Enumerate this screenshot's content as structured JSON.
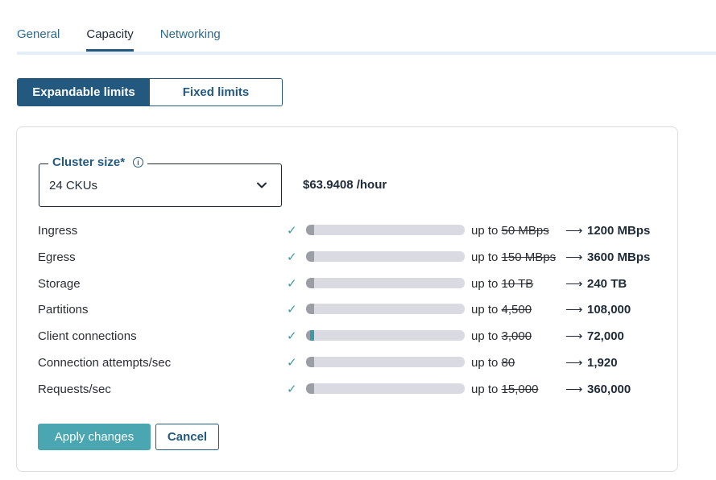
{
  "tabs": [
    {
      "label": "General",
      "active": false
    },
    {
      "label": "Capacity",
      "active": true
    },
    {
      "label": "Networking",
      "active": false
    }
  ],
  "limits_toggle": {
    "expandable_label": "Expandable limits",
    "fixed_label": "Fixed limits",
    "selected": "Expandable limits"
  },
  "cluster": {
    "label": "Cluster size*",
    "info_icon": "info-icon",
    "value": "24 CKUs",
    "price": "$63.9408 /hour"
  },
  "metrics": [
    {
      "label": "Ingress",
      "upto": "up to",
      "old": "50 MBps",
      "new": "1200 MBps",
      "fill": 0.05
    },
    {
      "label": "Egress",
      "upto": "up to",
      "old": "150 MBps",
      "new": "3600 MBps",
      "fill": 0.05
    },
    {
      "label": "Storage",
      "upto": "up to",
      "old": "10 TB",
      "new": "240 TB",
      "fill": 0.05
    },
    {
      "label": "Partitions",
      "upto": "up to",
      "old": "4,500",
      "new": "108,000",
      "fill": 0.05
    },
    {
      "label": "Client connections",
      "upto": "up to",
      "old": "3,000",
      "new": "72,000",
      "fill": 0.05,
      "accent": "#3d97a6"
    },
    {
      "label": "Connection attempts/sec",
      "upto": "up to",
      "old": "80",
      "new": "1,920",
      "fill": 0.05
    },
    {
      "label": "Requests/sec",
      "upto": "up to",
      "old": "15,000",
      "new": "360,000",
      "fill": 0.05
    }
  ],
  "icons": {
    "check": "✓",
    "arrow": "⟶",
    "chevron": "chevron-down-icon"
  },
  "actions": {
    "apply_label": "Apply changes",
    "cancel_label": "Cancel"
  },
  "colors": {
    "primary": "#24597f",
    "teal": "#4aa6b1",
    "bar_track": "#dadbe2",
    "bar_fill": "#9c9ea6"
  }
}
